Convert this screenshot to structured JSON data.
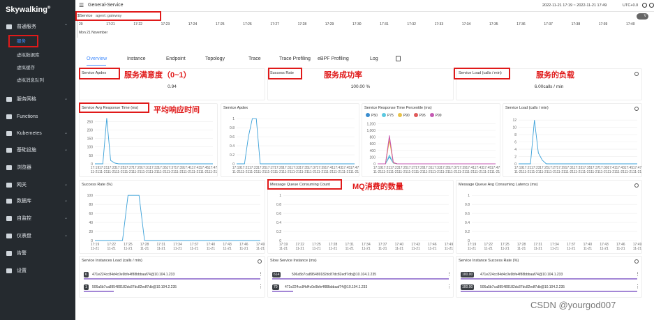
{
  "app": {
    "logo": "Skywalking",
    "logo_mark": "®"
  },
  "sidebar": {
    "items": [
      {
        "label": "普通服务",
        "icon": "layers-icon",
        "chevron": "⌃",
        "type": "group"
      },
      {
        "label": "服务",
        "type": "sub",
        "active": true
      },
      {
        "label": "虚拟数据库",
        "type": "sub"
      },
      {
        "label": "虚拟缓存",
        "type": "sub"
      },
      {
        "label": "虚拟消息队列",
        "type": "sub"
      },
      {
        "label": "服务网格",
        "icon": "mesh-icon",
        "chevron": "⌄",
        "type": "group"
      },
      {
        "label": "Functions",
        "icon": "cloud-icon",
        "chevron": "",
        "type": "group"
      },
      {
        "label": "Kubernetes",
        "icon": "kubernetes-icon",
        "chevron": "⌄",
        "type": "group"
      },
      {
        "label": "基础设施",
        "icon": "infra-icon",
        "chevron": "⌄",
        "type": "group"
      },
      {
        "label": "浏览器",
        "icon": "globe-icon",
        "chevron": "",
        "type": "group"
      },
      {
        "label": "网关",
        "icon": "gateway-icon",
        "chevron": "⌄",
        "type": "group"
      },
      {
        "label": "数据库",
        "icon": "database-icon",
        "chevron": "⌄",
        "type": "group"
      },
      {
        "label": "自监控",
        "icon": "selfobs-icon",
        "chevron": "⌄",
        "type": "group"
      },
      {
        "label": "仪表盘",
        "icon": "dashboard-icon",
        "chevron": "⌄",
        "type": "group"
      },
      {
        "label": "告警",
        "icon": "alarm-icon",
        "chevron": "",
        "type": "group"
      },
      {
        "label": "设置",
        "icon": "gear-icon",
        "chevron": "",
        "type": "group"
      }
    ]
  },
  "topbar": {
    "menu_icon": "☰",
    "layer": "General-Service",
    "time_range": "2022-11-21 17:19 ~ 2022-11-21 17:49",
    "timezone": "UTC+0.0"
  },
  "selector": {
    "label": "$Service",
    "value": "agent::gateway",
    "toggle": "V"
  },
  "timeline": {
    "ticks": [
      "20",
      "17:21",
      "17:22",
      "17:23",
      "17:24",
      "17:25",
      "17:26",
      "17:27",
      "17:28",
      "17:29",
      "17:30",
      "17:31",
      "17:32",
      "17:33",
      "17:34",
      "17:35",
      "17:36",
      "17:37",
      "17:38",
      "17:39",
      "17:40"
    ],
    "date": "Mon 21 November"
  },
  "tabs": [
    "Overview",
    "Instance",
    "Endpoint",
    "Topology",
    "Trace",
    "Trace Profiling",
    "eBPF Profiling",
    "Log"
  ],
  "cards": [
    {
      "title": "Service Apdex",
      "value": "0.94",
      "annotation": "服务满意度（0~1）"
    },
    {
      "title": "Success Rate",
      "value": "100.00 %",
      "annotation": "服务成功率"
    },
    {
      "title": "Service Load (calls / min)",
      "value": "6.00calls / min",
      "annotation": "服务的负载"
    }
  ],
  "x_ticks": [
    "17:19\n11-21",
    "17:21\n11-21",
    "17:23\n11-21",
    "17:25\n11-21",
    "17:27\n11-21",
    "17:29\n11-21",
    "17:31\n11-21",
    "17:33\n11-21",
    "17:35\n11-21",
    "17:37\n11-21",
    "17:39\n11-21",
    "17:41\n11-21",
    "17:43\n11-21",
    "17:45\n11-21",
    "17:47\n11-21",
    "17:49\n11-21"
  ],
  "chart_data": [
    {
      "id": "avg-rt",
      "type": "line",
      "title": "Service Avg Response Time (ms)",
      "annotation": "平均响应时间",
      "yticks": [
        "0",
        "50",
        "100",
        "150",
        "200",
        "250"
      ],
      "ylim": [
        0,
        280
      ],
      "series": [
        {
          "values": [
            0,
            0,
            0,
            270,
            20,
            5,
            0,
            0,
            0,
            0,
            0,
            0,
            0,
            0,
            0,
            0,
            0,
            0,
            0,
            0,
            0,
            0,
            0,
            0,
            0,
            0,
            0,
            0,
            0,
            0,
            0
          ]
        }
      ],
      "xticks": [
        "17:19",
        "17:21",
        "17:23",
        "17:25",
        "17:27",
        "17:29",
        "17:31",
        "17:33",
        "17:35",
        "17:37",
        "17:39",
        "17:41",
        "17:43",
        "17:45",
        "17:47"
      ]
    },
    {
      "id": "apdex",
      "type": "line",
      "title": "Service Apdex",
      "yticks": [
        "0",
        "0.2",
        "0.4",
        "0.6",
        "0.8",
        "1"
      ],
      "ylim": [
        0,
        1.05
      ],
      "series": [
        {
          "values": [
            0,
            0,
            0,
            0.6,
            1,
            1,
            0,
            0,
            0,
            0,
            0,
            0,
            0,
            0,
            0,
            0,
            0,
            0,
            0,
            0,
            0,
            0,
            0,
            0,
            0,
            0,
            0,
            0,
            0,
            0,
            0
          ]
        }
      ],
      "xticks": [
        "17:19",
        "17:21",
        "17:23",
        "17:25",
        "17:27",
        "17:29",
        "17:31",
        "17:33",
        "17:35",
        "17:37",
        "17:39",
        "17:41",
        "17:43",
        "17:45",
        "17:47"
      ]
    },
    {
      "id": "percentile",
      "type": "line",
      "title": "Service Response Time Percentile (ms)",
      "legend": [
        "P50",
        "P75",
        "P90",
        "P95",
        "P99"
      ],
      "legend_colors": [
        "#3a8dcf",
        "#5bc8e0",
        "#e8c24a",
        "#e05a5a",
        "#c45ab3"
      ],
      "yticks": [
        "0",
        "200",
        "400",
        "600",
        "800",
        "1,000",
        "1,200"
      ],
      "ylim": [
        0,
        1250
      ],
      "series": [
        {
          "name": "P50",
          "values": [
            0,
            0,
            0,
            210,
            20,
            0,
            0,
            0,
            0,
            0,
            0,
            0,
            0,
            0,
            0,
            0,
            0,
            0,
            0,
            0,
            0,
            0,
            0,
            0,
            0,
            0,
            0,
            0,
            0,
            0,
            0
          ]
        },
        {
          "name": "P75",
          "values": [
            0,
            0,
            0,
            260,
            20,
            0,
            0,
            0,
            0,
            0,
            0,
            0,
            0,
            0,
            0,
            0,
            0,
            0,
            0,
            0,
            0,
            0,
            0,
            0,
            0,
            0,
            0,
            0,
            0,
            0,
            0
          ]
        },
        {
          "name": "P90",
          "values": [
            0,
            0,
            0,
            700,
            30,
            0,
            0,
            0,
            0,
            0,
            0,
            0,
            0,
            0,
            0,
            0,
            0,
            0,
            0,
            0,
            0,
            0,
            0,
            0,
            0,
            0,
            0,
            0,
            0,
            0,
            0
          ]
        },
        {
          "name": "P95",
          "values": [
            0,
            0,
            0,
            800,
            40,
            0,
            0,
            0,
            0,
            0,
            0,
            0,
            0,
            0,
            0,
            0,
            0,
            0,
            0,
            0,
            0,
            0,
            0,
            0,
            0,
            0,
            0,
            0,
            0,
            0,
            0
          ]
        },
        {
          "name": "P99",
          "values": [
            0,
            0,
            0,
            850,
            40,
            0,
            0,
            0,
            0,
            0,
            0,
            0,
            0,
            0,
            0,
            0,
            0,
            0,
            0,
            0,
            0,
            0,
            0,
            0,
            0,
            0,
            0,
            0,
            0,
            0,
            0
          ]
        }
      ],
      "xticks": [
        "17:19",
        "17:21",
        "17:23",
        "17:25",
        "17:27",
        "17:29",
        "17:31",
        "17:33",
        "17:35",
        "17:37",
        "17:39",
        "17:41",
        "17:43",
        "17:45",
        "17:47"
      ]
    },
    {
      "id": "load",
      "type": "line",
      "title": "Service Load (calls / min)",
      "yticks": [
        "0",
        "2",
        "4",
        "6",
        "8",
        "10",
        "12"
      ],
      "ylim": [
        0,
        13
      ],
      "series": [
        {
          "values": [
            0,
            0,
            0,
            0,
            12,
            3,
            1,
            0,
            0,
            0,
            0,
            0,
            0,
            0,
            0,
            0,
            0,
            0,
            0,
            0,
            0,
            0,
            0,
            0,
            0,
            0,
            0,
            0,
            0,
            0,
            0
          ]
        }
      ],
      "xticks": [
        "17:19",
        "17:21",
        "17:23",
        "17:25",
        "17:27",
        "17:29",
        "17:31",
        "17:33",
        "17:35",
        "17:37",
        "17:39",
        "17:41",
        "17:43",
        "17:45",
        "17:47"
      ]
    },
    {
      "id": "success-rate",
      "type": "line",
      "title": "Success Rate (%)",
      "yticks": [
        "0",
        "20",
        "40",
        "60",
        "80",
        "100"
      ],
      "ylim": [
        0,
        105
      ],
      "series": [
        {
          "values": [
            0,
            0,
            0,
            0,
            0,
            0,
            100,
            100,
            100,
            0,
            0,
            0,
            0,
            0,
            0,
            0,
            0,
            0,
            0,
            0,
            0,
            0,
            0,
            0,
            0,
            0,
            0,
            0,
            0,
            0,
            0
          ]
        }
      ],
      "xticks": [
        "17:19",
        "17:22",
        "17:25",
        "17:28",
        "17:31",
        "17:34",
        "17:37",
        "17:40",
        "17:43",
        "17:46",
        "17:49"
      ]
    },
    {
      "id": "mq-count",
      "type": "line",
      "title": "Message Queue Consuming Count",
      "annotation": "MQ消费的数量",
      "yticks": [
        "0",
        "0.2",
        "0.4",
        "0.6",
        "0.8",
        "1"
      ],
      "ylim": [
        0,
        1.05
      ],
      "series": [
        {
          "values": []
        }
      ],
      "xticks": [
        "17:19",
        "17:22",
        "17:25",
        "17:28",
        "17:31",
        "17:34",
        "17:37",
        "17:40",
        "17:43",
        "17:46",
        "17:49"
      ]
    },
    {
      "id": "mq-latency",
      "type": "line",
      "title": "Message Queue Avg Consuming Latency (ms)",
      "yticks": [
        "0",
        "0.2",
        "0.4",
        "0.6",
        "0.8",
        "1"
      ],
      "ylim": [
        0,
        1.05
      ],
      "series": [
        {
          "values": []
        }
      ],
      "xticks": [
        "17:19",
        "17:22",
        "17:25",
        "17:28",
        "17:31",
        "17:34",
        "17:37",
        "17:40",
        "17:43",
        "17:46",
        "17:49"
      ]
    }
  ],
  "lists": [
    {
      "title": "Service Instances Load (calls / min)",
      "rows": [
        {
          "badge": "6",
          "text": "471e224cc84d4c0e9bfe4f88bbbaaf74@10.104.1.233",
          "fill": 1.0
        },
        {
          "badge": "1",
          "text": "506a5b7ca895489182dc87dc82edf7db@10.104.2.235",
          "fill": 0.17
        }
      ]
    },
    {
      "title": "Slow Service Instance (ms)",
      "rows": [
        {
          "badge": "614",
          "text": "506a5b7ca895489182dc87dc82edf7db@10.104.2.235",
          "fill": 1.0
        },
        {
          "badge": "70",
          "text": "471e224cc84d4c0e9bfe4f88bbbaaf74@10.104.1.233",
          "fill": 0.12
        }
      ]
    },
    {
      "title": "Service Instance Success Rate (%)",
      "rows": [
        {
          "badge": "100.00",
          "text": "471e224cc84d4c0e9bfe4f88bbbaaf74@10.104.1.233",
          "fill": 1.0
        },
        {
          "badge": "100.00",
          "text": "506a5b7ca895489182dc87dc82edf7db@10.104.2.235",
          "fill": 1.0
        }
      ]
    }
  ],
  "watermark": "CSDN @yourgod007",
  "colors": {
    "sidebar": "#252a2f",
    "accent": "#448dfe",
    "line": "#3aa0d8",
    "highlight": "#e01a1a",
    "bar": "#a487d6"
  }
}
